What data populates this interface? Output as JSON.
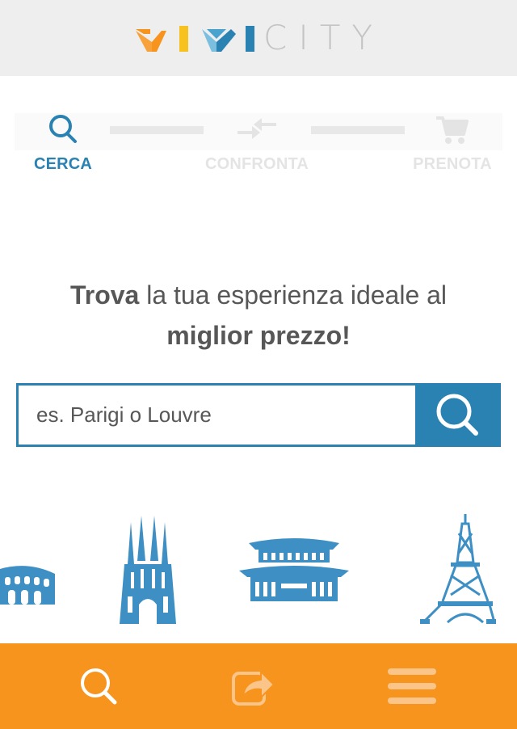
{
  "header": {
    "logo_text": "CITY",
    "logo_colors": [
      "#f7941d",
      "#f7c21d",
      "#2a82b3",
      "#7bbfe0",
      "#c4c4c4"
    ]
  },
  "steps": [
    {
      "label": "CERCA",
      "icon": "search-icon",
      "active": true
    },
    {
      "label": "CONFRONTA",
      "icon": "compare-arrows-icon",
      "active": false
    },
    {
      "label": "PRENOTA",
      "icon": "cart-icon",
      "active": false
    }
  ],
  "headline": {
    "bold_1": "Trova",
    "normal_1": " la tua esperienza ideale al",
    "bold_2": "miglior prezzo!"
  },
  "search": {
    "placeholder": "es. Parigi o Louvre",
    "value": ""
  },
  "landmarks": [
    "colosseum-icon",
    "sagrada-familia-icon",
    "asian-palace-icon",
    "eiffel-tower-icon"
  ],
  "bottom_bar": {
    "items": [
      "search-icon",
      "share-icon",
      "menu-icon"
    ]
  },
  "colors": {
    "primary_blue": "#2a82b3",
    "accent_orange": "#f7941d",
    "text_gray": "#575757",
    "inactive_gray": "#e4e4e4"
  }
}
